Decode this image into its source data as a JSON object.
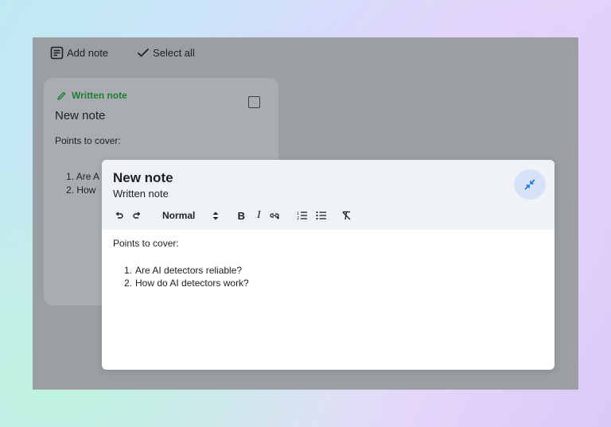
{
  "toolbar": {
    "add_note_label": "Add note",
    "select_all_label": "Select all"
  },
  "background_card": {
    "tag": "Written note",
    "title": "New note",
    "body_intro": "Points to cover:",
    "list": [
      {
        "num": "1.",
        "text": "Are A"
      },
      {
        "num": "2.",
        "text": "How"
      }
    ]
  },
  "modal": {
    "title": "New note",
    "subtitle": "Written note",
    "format_style": "Normal",
    "body_intro": "Points to cover:",
    "list": [
      {
        "num": "1.",
        "text": "Are AI detectors reliable?"
      },
      {
        "num": "2.",
        "text": "How do AI detectors work?"
      }
    ]
  },
  "colors": {
    "tag_green": "#1e7e34",
    "collapse_button_bg": "#d6e3f7",
    "accent_blue": "#1a73e8"
  },
  "icons": {
    "add_note": "note-add-icon",
    "select_all": "check-icon",
    "tag": "pencil-icon",
    "collapse": "collapse-arrows-icon",
    "undo": "undo-icon",
    "redo": "redo-icon",
    "bold": "bold-icon",
    "italic": "italic-icon",
    "link": "link-icon",
    "numbered_list": "numbered-list-icon",
    "bulleted_list": "bulleted-list-icon",
    "clear_format": "clear-format-icon"
  }
}
